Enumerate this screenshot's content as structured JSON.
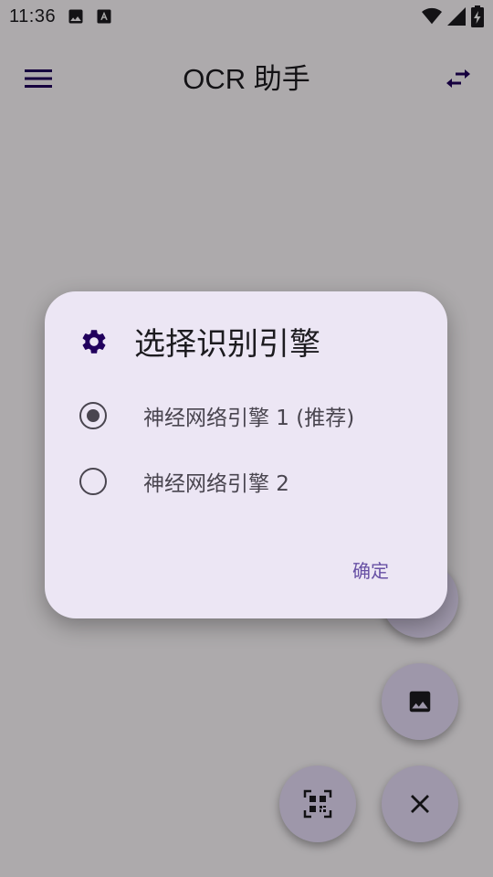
{
  "status_bar": {
    "time": "11:36",
    "icons": [
      "image-icon",
      "font-icon",
      "wifi-icon",
      "signal-icon",
      "battery-charging-icon"
    ]
  },
  "app_bar": {
    "title": "OCR 助手",
    "menu_icon": "menu-icon",
    "swap_icon": "swap-icon"
  },
  "dialog": {
    "icon": "gear-icon",
    "title": "选择识别引擎",
    "options": [
      {
        "label": "神经网络引擎 1 (推荐)",
        "selected": true
      },
      {
        "label": "神经网络引擎 2",
        "selected": false
      }
    ],
    "confirm_label": "确定"
  },
  "fabs": [
    {
      "icon": "image-icon"
    },
    {
      "icon": "qr-scan-icon"
    },
    {
      "icon": "close-icon"
    }
  ],
  "colors": {
    "accent": "#6750a4",
    "dialog_bg": "#ece6f4",
    "fab_bg": "#e9dffb",
    "icon_dark": "#21005d"
  }
}
